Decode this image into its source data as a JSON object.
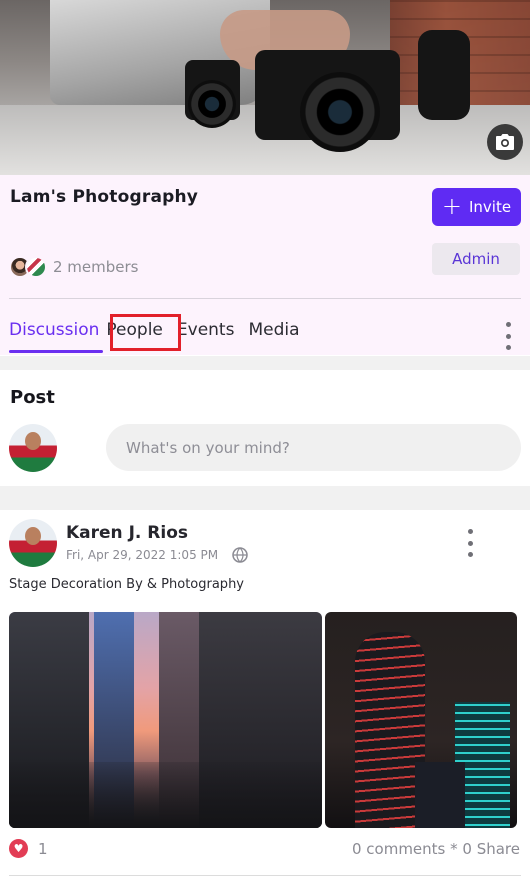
{
  "group": {
    "name": "Lam's Photography",
    "invite_label": "Invite",
    "admin_label": "Admin",
    "members_text": "2 members"
  },
  "tabs": [
    {
      "label": "Discussion",
      "active": true
    },
    {
      "label": "People",
      "active": false
    },
    {
      "label": "Events",
      "active": false
    },
    {
      "label": "Media",
      "active": false
    }
  ],
  "composer": {
    "title": "Post",
    "placeholder": "What's on your mind?"
  },
  "post": {
    "author": "Karen J. Rios",
    "date": "Fri, Apr 29, 2022 1:05 PM",
    "caption": "Stage Decoration By & Photography",
    "reaction_count": "1",
    "stats": "0 comments * 0 Share"
  },
  "icons": {
    "cover_camera": "camera-icon",
    "invite": "plus-icon",
    "more": "more-vertical-icon",
    "privacy": "globe-icon",
    "reaction": "heart-icon"
  },
  "colors": {
    "accent": "#5f2bf3",
    "active_tab": "#6a2ff0",
    "header_bg": "#fdf3fd",
    "highlight": "#e2202a",
    "heart": "#e23d55"
  }
}
